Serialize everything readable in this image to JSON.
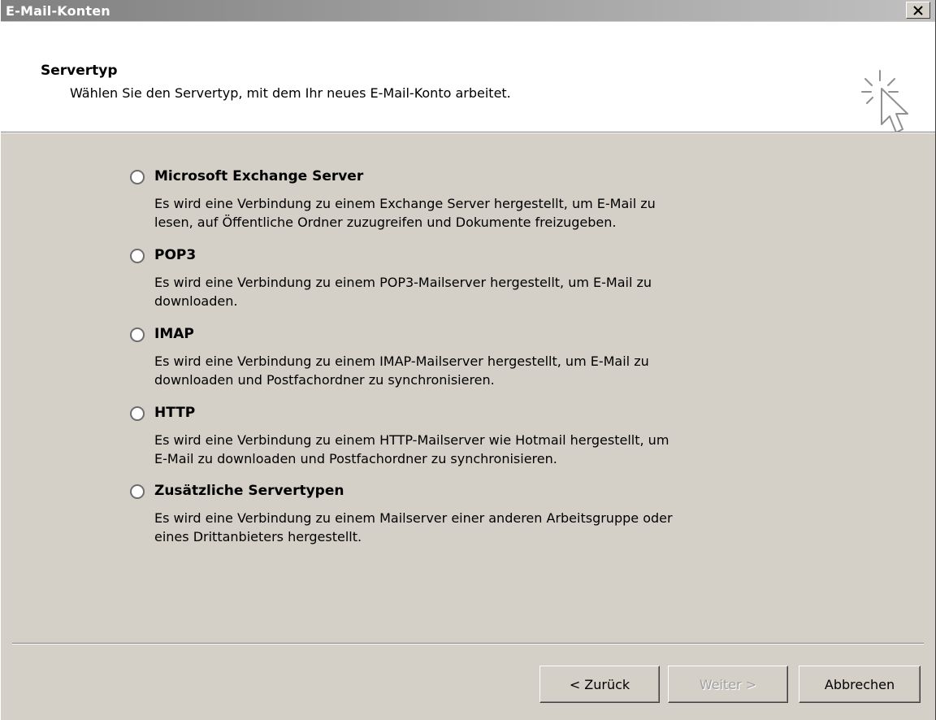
{
  "window": {
    "title": "E-Mail-Konten"
  },
  "header": {
    "title": "Servertyp",
    "subtitle": "Wählen Sie den Servertyp, mit dem Ihr neues E-Mail-Konto arbeitet.",
    "icon": "wizard-cursor-icon"
  },
  "options": [
    {
      "label": "Microsoft Exchange Server",
      "selected": false,
      "desc1": "Es wird eine Verbindung zu einem Exchange Server hergestellt, um E-Mail zu",
      "desc2": "lesen, auf Öffentliche Ordner zuzugreifen und Dokumente freizugeben."
    },
    {
      "label": "POP3",
      "selected": false,
      "desc1": "Es wird eine Verbindung zu einem POP3-Mailserver hergestellt, um E-Mail zu",
      "desc2": "downloaden."
    },
    {
      "label": "IMAP",
      "selected": false,
      "desc1": "Es wird eine Verbindung zu einem IMAP-Mailserver hergestellt, um E-Mail zu",
      "desc2": "downloaden und Postfachordner zu synchronisieren."
    },
    {
      "label": "HTTP",
      "selected": false,
      "desc1": "Es wird eine Verbindung zu einem HTTP-Mailserver wie Hotmail hergestellt, um",
      "desc2": "E-Mail zu downloaden und Postfachordner zu synchronisieren."
    },
    {
      "label": "Zusätzliche Servertypen",
      "selected": false,
      "desc1": "Es wird eine Verbindung zu einem Mailserver einer anderen Arbeitsgruppe oder",
      "desc2": "eines Drittanbieters hergestellt."
    }
  ],
  "buttons": {
    "back": "< Zurück",
    "next": "Weiter >",
    "next_enabled": false,
    "cancel": "Abbrechen"
  },
  "colors": {
    "dialog_face": "#d4d0c8",
    "titlebar_start": "#808080",
    "titlebar_end": "#c0c0c0",
    "header_bg": "#ffffff",
    "disabled_text": "#a0a0a0"
  }
}
